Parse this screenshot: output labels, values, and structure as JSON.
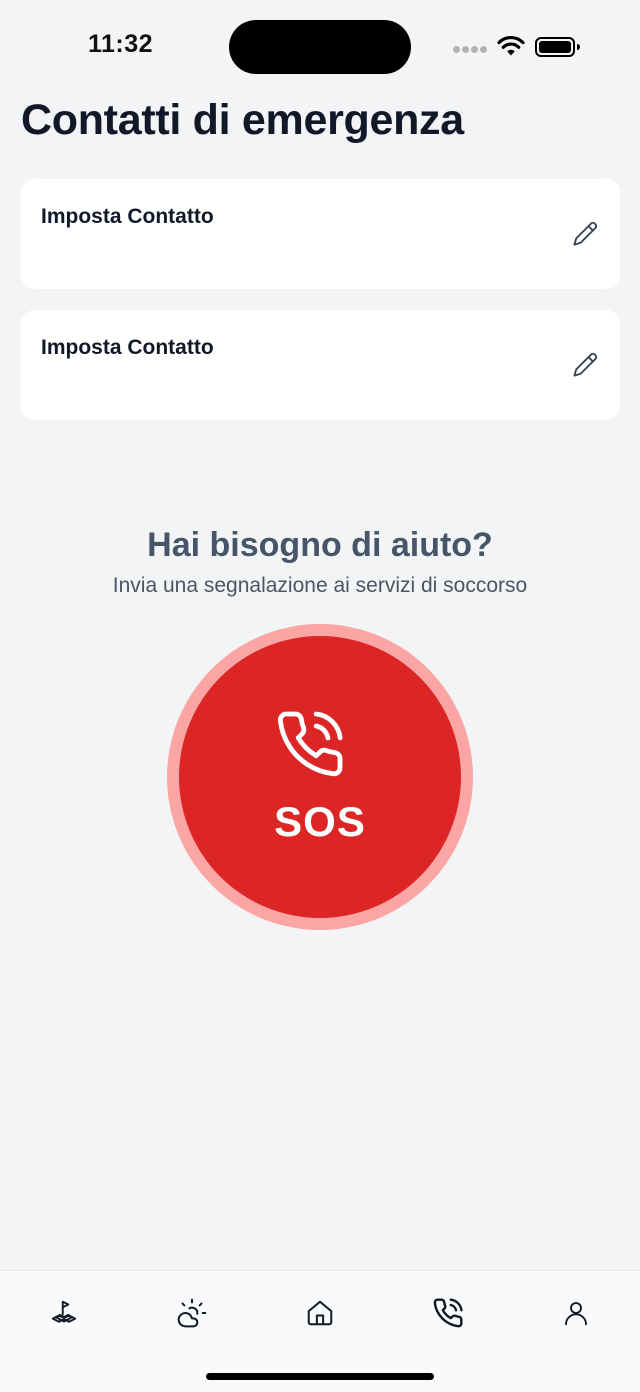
{
  "status_bar": {
    "time": "11:32"
  },
  "page": {
    "title": "Contatti di emergenza"
  },
  "contacts": [
    {
      "label": "Imposta Contatto",
      "icon": "pencil-icon"
    },
    {
      "label": "Imposta Contatto",
      "icon": "pencil-icon"
    }
  ],
  "help": {
    "title": "Hai bisogno di aiuto?",
    "subtitle": "Invia una segnalazione ai servizi di soccorso"
  },
  "sos": {
    "label": "SOS",
    "icon": "phone-ringing-icon",
    "color": "#dc2626",
    "ring_color": "#fca5a5"
  },
  "bottom_nav": {
    "items": [
      {
        "name": "map-flag-icon",
        "active": false
      },
      {
        "name": "weather-icon",
        "active": false
      },
      {
        "name": "home-icon",
        "active": false
      },
      {
        "name": "phone-ringing-icon",
        "active": true
      },
      {
        "name": "user-icon",
        "active": false
      }
    ]
  }
}
